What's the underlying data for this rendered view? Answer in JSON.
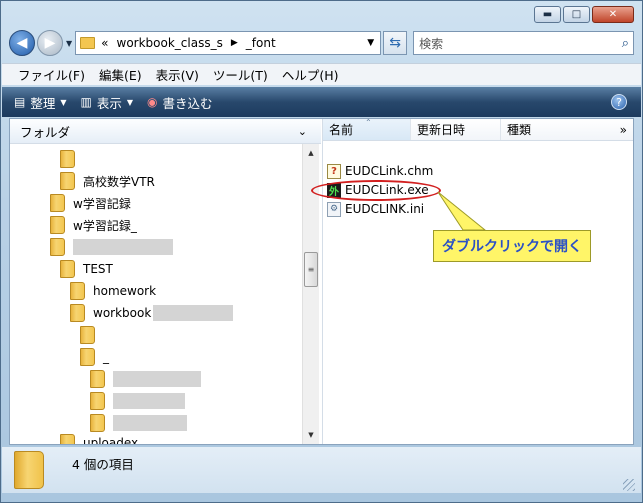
{
  "window": {
    "minimize": "▬",
    "maximize": "□",
    "close": "✕"
  },
  "address": {
    "prefix": "«",
    "part1": "workbook_class_s",
    "part2": "_font",
    "search_placeholder": "検索"
  },
  "menu": [
    "ファイル(F)",
    "編集(E)",
    "表示(V)",
    "ツール(T)",
    "ヘルプ(H)"
  ],
  "toolbar": {
    "organize": "整理",
    "views": "表示",
    "burn": "書き込む",
    "help": "?"
  },
  "folder_pane": {
    "header": "フォルダ",
    "items": [
      "高校数学VTR",
      "w学習記録",
      "w学習記録_",
      "TEST",
      "homework",
      "workbook",
      "_",
      "uploadex"
    ]
  },
  "columns": {
    "name": "名前",
    "date": "更新日時",
    "type": "種類"
  },
  "files": [
    {
      "name": "EUDCLink.chm",
      "icon": "help-file-icon"
    },
    {
      "name": "EUDCLink.exe",
      "icon": "exe-gaiji-icon",
      "glyph": "外"
    },
    {
      "name": "EUDCLINK.ini",
      "icon": "config-file-icon"
    }
  ],
  "callout": "ダブルクリックで開く",
  "details": {
    "count_text": "4 個の項目"
  },
  "colors": {
    "highlight_ellipse": "#d21f1f",
    "callout_bg": "#fff568",
    "callout_text": "#2a50c6"
  }
}
